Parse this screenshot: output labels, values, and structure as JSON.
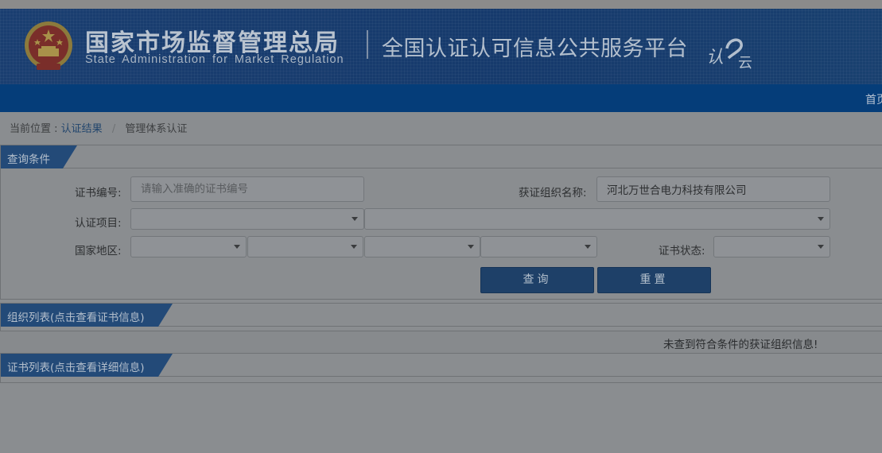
{
  "header": {
    "org_name_cn": "国家市场监督管理总局",
    "org_name_en": "State Administration  for  Market Regulation",
    "platform_title": "全国认证认可信息公共服务平台",
    "logo_mark_text": "认云",
    "emblem_icon": "national-emblem-icon"
  },
  "nav": {
    "home": "首页"
  },
  "breadcrumb": {
    "prefix": "当前位置 :",
    "link": "认证结果",
    "separator": "/",
    "current": "管理体系认证"
  },
  "query_panel": {
    "title": "查询条件",
    "cert_no_label": "证书编号:",
    "cert_no_placeholder": "请输入准确的证书编号",
    "cert_no_value": "",
    "org_name_label": "获证组织名称:",
    "org_name_value": "河北万世合电力科技有限公司",
    "project_label": "认证项目:",
    "region_label": "国家地区:",
    "status_label": "证书状态:",
    "search_button": "查询",
    "reset_button": "重置"
  },
  "org_list": {
    "title": "组织列表(点击查看证书信息)",
    "empty_message": "未查到符合条件的获证组织信息!"
  },
  "cert_list": {
    "title": "证书列表(点击查看详细信息)"
  },
  "colors": {
    "header_bg": "#163a6c",
    "nav_bg": "#053d79",
    "tag_bg": "#234a78",
    "button_bg": "#1e4068",
    "page_bg": "#8a8d90"
  }
}
